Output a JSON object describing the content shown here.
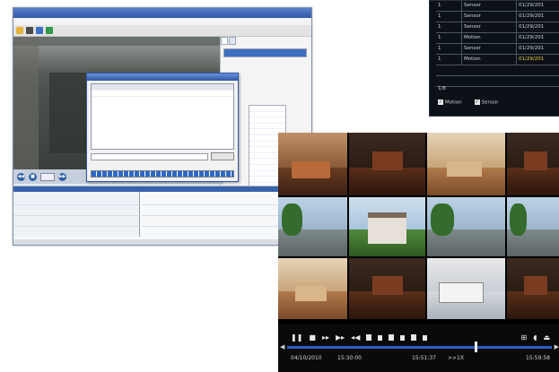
{
  "event_list": {
    "rows": [
      {
        "ch": "1",
        "type": "Sensor",
        "time": "01/29/201",
        "highlight": false
      },
      {
        "ch": "1",
        "type": "Sensor",
        "time": "01/29/201",
        "highlight": false
      },
      {
        "ch": "1",
        "type": "Sensor",
        "time": "01/29/201",
        "highlight": false
      },
      {
        "ch": "1",
        "type": "Motion",
        "time": "01/29/201",
        "highlight": false
      },
      {
        "ch": "1",
        "type": "Sensor",
        "time": "01/29/201",
        "highlight": false
      },
      {
        "ch": "1",
        "type": "Motion",
        "time": "01/29/201",
        "highlight": true
      }
    ],
    "page": "1/8",
    "filters": [
      {
        "label": "Motion",
        "checked": true
      },
      {
        "label": "Sensor",
        "checked": true
      }
    ]
  },
  "dvr": {
    "playback": {
      "date": "04/10/2010",
      "start_time": "15:30:00",
      "current_time": "15:51:37",
      "speed": ">>1X",
      "end_time": "15:59:58",
      "progress": 0.71
    }
  },
  "colors": {
    "dvr_seek_bar": "#2f5fc8",
    "event_highlight": "#f0d23c",
    "window_titlebar": "#2f58a8"
  }
}
